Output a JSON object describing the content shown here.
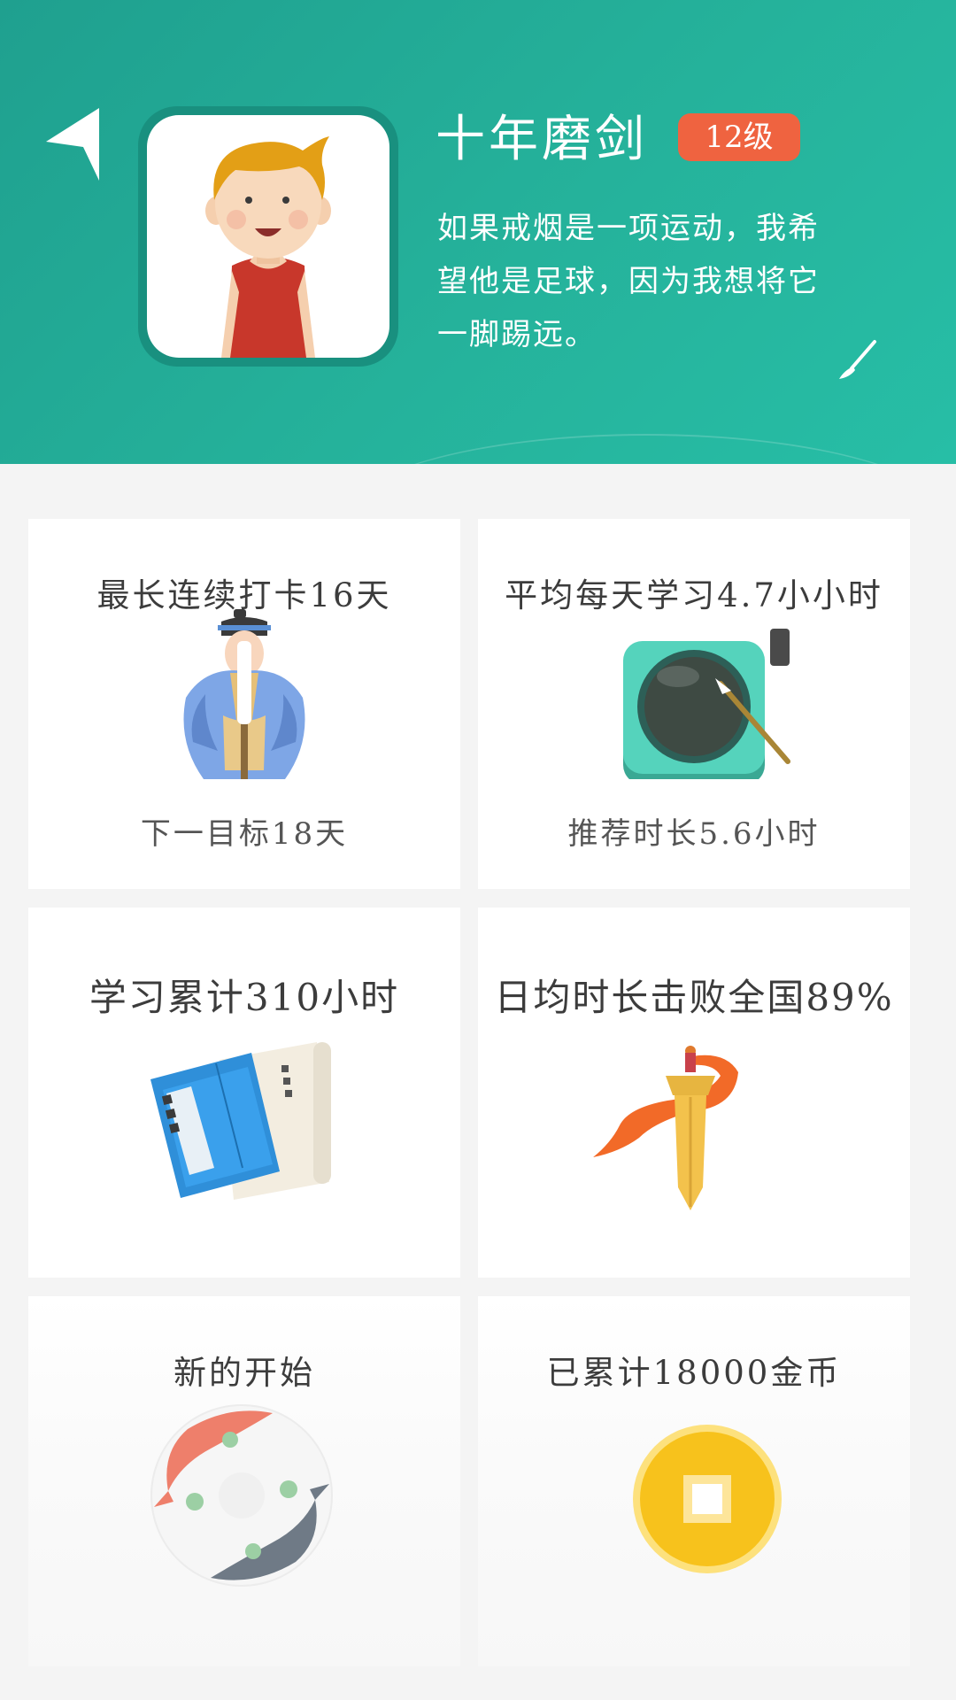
{
  "header": {
    "username": "十年磨剑",
    "level": "12级",
    "motto_lines": [
      "如果戒烟是一项运动，我希",
      "望他是足球，因为我想将它",
      "一脚踢远。"
    ]
  },
  "cards": [
    {
      "title": "最长连续打卡16天",
      "subtitle": "下一目标18天",
      "icon": "scholar-icon"
    },
    {
      "title": "平均每天学习4.7小小时",
      "subtitle": "推荐时长5.6小时",
      "icon": "inkstone-icon"
    },
    {
      "title": "学习累计310小时",
      "icon": "book-scroll-icon"
    },
    {
      "title": "日均时长击败全国89%",
      "icon": "sword-icon"
    },
    {
      "title": "新的开始",
      "icon": "koi-fish-icon"
    },
    {
      "title": "已累计18000金币",
      "icon": "gold-coin-icon"
    }
  ],
  "colors": {
    "header_green": "#25b29b",
    "level_badge": "#ef6340",
    "coin_yellow": "#f7c21c"
  }
}
